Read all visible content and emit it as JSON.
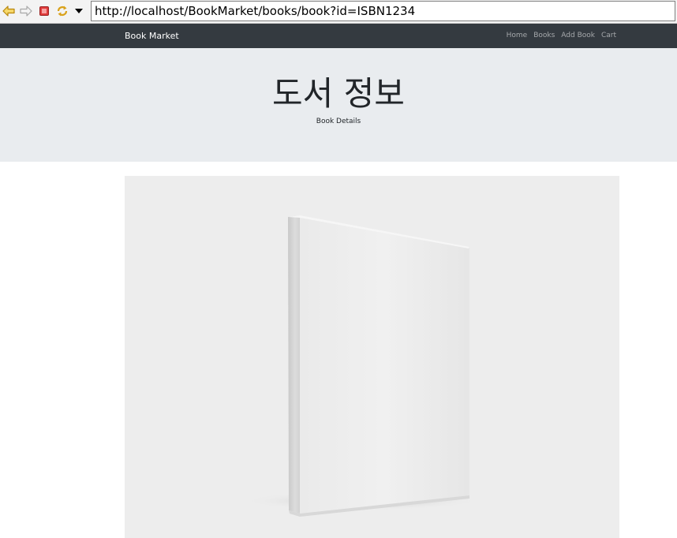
{
  "browser": {
    "url": "http://localhost/BookMarket/books/book?id=ISBN1234",
    "icons": [
      "back-icon",
      "forward-icon",
      "stop-icon",
      "refresh-icon",
      "dropdown-arrow-icon"
    ]
  },
  "navbar": {
    "brand": "Book Market",
    "links": [
      "Home",
      "Books",
      "Add Book",
      "Cart"
    ]
  },
  "jumbotron": {
    "title": "도서 정보",
    "subtitle": "Book Details"
  },
  "main": {
    "image_description_icon": "book-cover-image"
  },
  "colors": {
    "navbar_bg": "#343a40",
    "jumbotron_bg": "#e9ecef",
    "image_bg": "#ededed"
  }
}
